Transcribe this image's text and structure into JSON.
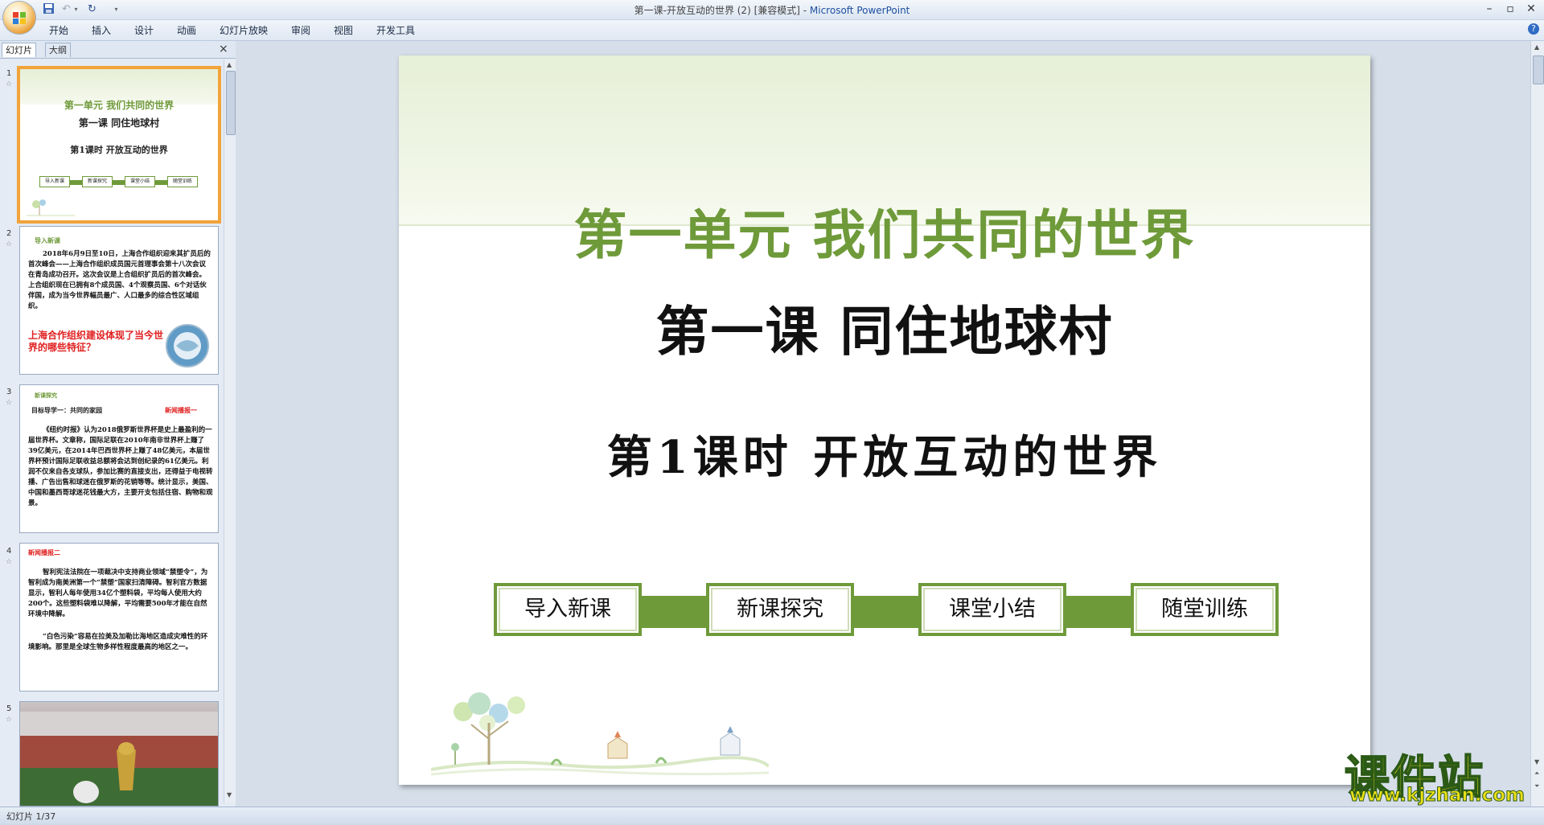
{
  "window": {
    "title": "第一课-开放互动的世界 (2) [兼容模式] - ",
    "app_name": "Microsoft PowerPoint"
  },
  "ribbon": {
    "tabs": [
      "开始",
      "插入",
      "设计",
      "动画",
      "幻灯片放映",
      "审阅",
      "视图",
      "开发工具"
    ]
  },
  "panel": {
    "tab_slides": "幻灯片",
    "tab_outline": "大纲",
    "close": "×"
  },
  "thumbnails": {
    "s1": {
      "num": "1",
      "unit": "第一单元  我们共同的世界",
      "lesson": "第一课  同住地球村",
      "period": "第1课时  开放互动的世界",
      "nav": [
        "导入新课",
        "新课探究",
        "课堂小结",
        "随堂训练"
      ]
    },
    "s2": {
      "num": "2",
      "label": "导入新课",
      "body": "2018年6月9日至10日，上海合作组织迎来其扩员后的首次峰会——上海合作组织成员国元首理事会第十八次会议在青岛成功召开。这次会议是上合组织扩员后的首次峰会。上合组织现在已拥有8个成员国、4个观察员国、6个对话伙伴国，成为当今世界幅员最广、人口最多的综合性区域组织。",
      "question": "上海合作组织建设体现了当今世界的哪些特征？"
    },
    "s3": {
      "num": "3",
      "label": "新课探究",
      "goal": "目标导学一：共同的家园",
      "tag": "新闻播报一",
      "body": "《纽约时报》认为2018俄罗斯世界杯是史上最盈利的一届世界杯。文章称，国际足联在2010年南非世界杯上赚了39亿美元，在2014年巴西世界杯上赚了48亿美元，本届世界杯预计国际足联收益总额将会达到创纪录的61亿美元。利润不仅来自各支球队，参加比赛的直接支出，还得益于电视转播、广告出售和球迷在俄罗斯的花销等等。统计显示，美国、中国和墨西哥球迷花钱最大方，主要开支包括住宿、购物和观景。"
    },
    "s4": {
      "num": "4",
      "tag": "新闻播报二",
      "body1": "智利宪法法院在一项裁决中支持商业领域“禁塑令”，为智利成为南美洲第一个“禁塑”国家扫清障碍。智利官方数据显示，智利人每年使用34亿个塑料袋，平均每人使用大约200个。这些塑料袋难以降解，平均需要500年才能在自然环境中降解。",
      "body2": "“白色污染”容易在拉美及加勒比海地区造成灾难性的环境影响。那里是全球生物多样性程度最高的地区之一。"
    },
    "s5": {
      "num": "5"
    }
  },
  "slide": {
    "unit_title": "第一单元  我们共同的世界",
    "lesson_title": "第一课  同住地球村",
    "period_title": "第1课时  开放互动的世界",
    "nav": [
      "导入新课",
      "新课探究",
      "课堂小结",
      "随堂训练"
    ]
  },
  "watermark": {
    "main": "课件站",
    "url": "www.kjzhan.com"
  },
  "status": {
    "slide_counter": "幻灯片 1/37"
  },
  "colors": {
    "accent_green": "#6f9a3a",
    "highlight_orange": "#f2a33a",
    "question_red": "#e02020"
  }
}
